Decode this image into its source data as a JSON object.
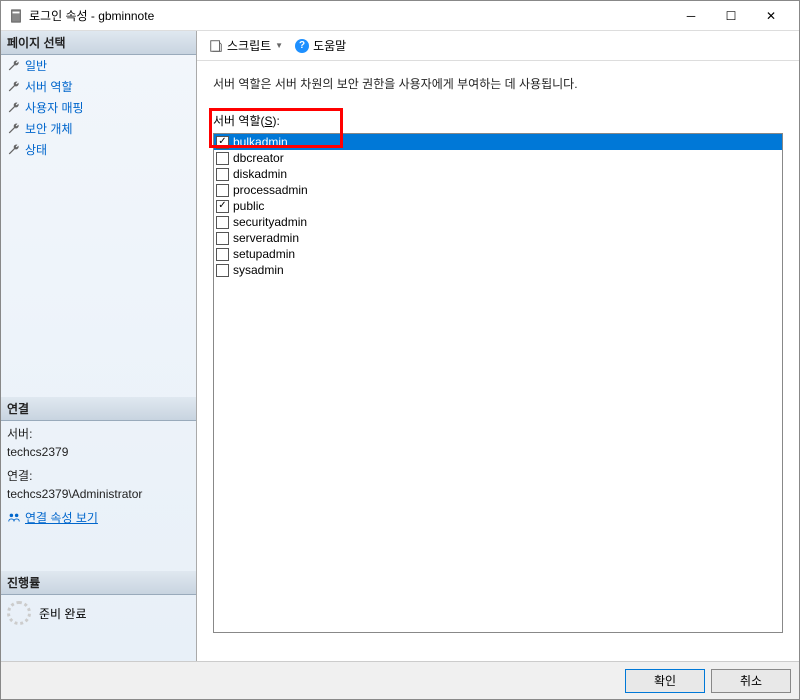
{
  "window": {
    "title": "로그인 속성 - gbminnote"
  },
  "sidebar": {
    "page_select_header": "페이지 선택",
    "items": [
      {
        "label": "일반"
      },
      {
        "label": "서버 역할"
      },
      {
        "label": "사용자 매핑"
      },
      {
        "label": "보안 개체"
      },
      {
        "label": "상태"
      }
    ],
    "connection_header": "연결",
    "server_label": "서버:",
    "server_value": "techcs2379",
    "connection_label": "연결:",
    "connection_value": "techcs2379\\Administrator",
    "view_conn_props": "연결 속성 보기",
    "progress_header": "진행률",
    "progress_status": "준비 완료"
  },
  "toolbar": {
    "script": "스크립트",
    "help": "도움말"
  },
  "main": {
    "description": "서버 역할은 서버 차원의 보안 권한을 사용자에게 부여하는 데 사용됩니다.",
    "roles_label_pre": "서버 역할(",
    "roles_label_key": "S",
    "roles_label_post": "):",
    "roles": [
      {
        "name": "bulkadmin",
        "checked": true,
        "selected": true
      },
      {
        "name": "dbcreator",
        "checked": false,
        "selected": false
      },
      {
        "name": "diskadmin",
        "checked": false,
        "selected": false
      },
      {
        "name": "processadmin",
        "checked": false,
        "selected": false
      },
      {
        "name": "public",
        "checked": true,
        "selected": false
      },
      {
        "name": "securityadmin",
        "checked": false,
        "selected": false
      },
      {
        "name": "serveradmin",
        "checked": false,
        "selected": false
      },
      {
        "name": "setupadmin",
        "checked": false,
        "selected": false
      },
      {
        "name": "sysadmin",
        "checked": false,
        "selected": false
      }
    ]
  },
  "footer": {
    "ok": "확인",
    "cancel": "취소"
  }
}
